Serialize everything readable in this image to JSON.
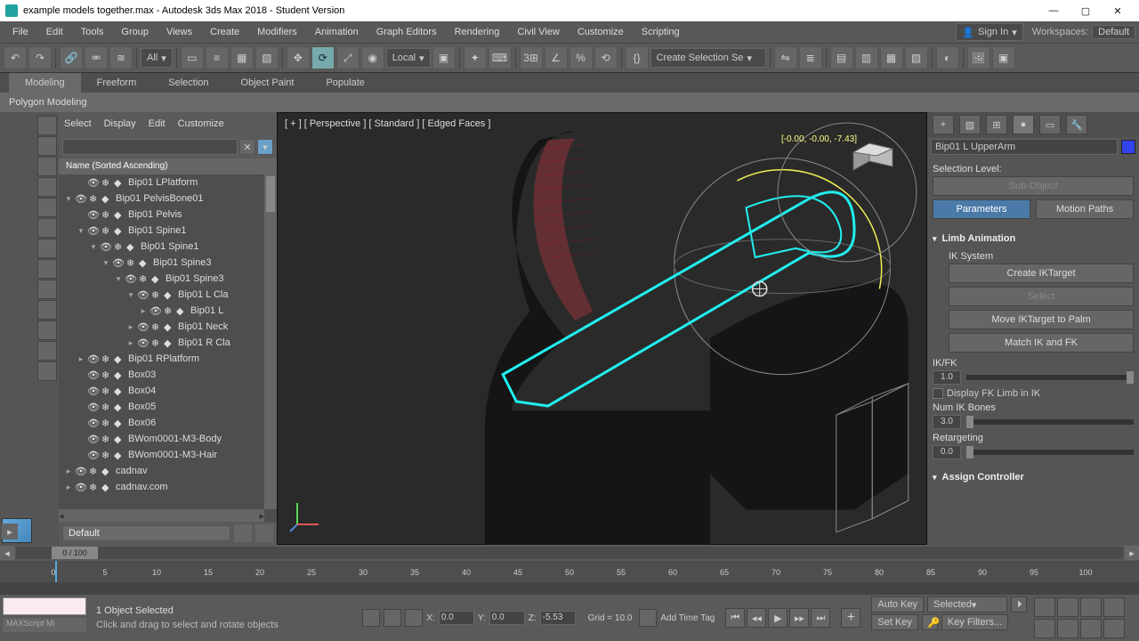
{
  "window": {
    "title": "example models together.max - Autodesk 3ds Max 2018 - Student Version"
  },
  "menu": {
    "items": [
      "File",
      "Edit",
      "Tools",
      "Group",
      "Views",
      "Create",
      "Modifiers",
      "Animation",
      "Graph Editors",
      "Rendering",
      "Civil View",
      "Customize",
      "Scripting"
    ],
    "signin_icon": "person",
    "signin_label": "Sign In",
    "workspaces_label": "Workspaces:",
    "workspaces_value": "Default"
  },
  "toolbar": {
    "coord_select": "All",
    "coord_system": "Local",
    "named_sel": "Create Selection Se"
  },
  "ribbon": {
    "tabs": [
      "Modeling",
      "Freeform",
      "Selection",
      "Object Paint",
      "Populate"
    ],
    "active_index": 0,
    "sub_label": "Polygon Modeling"
  },
  "scene": {
    "menus": [
      "Select",
      "Display",
      "Edit",
      "Customize"
    ],
    "col_header": "Name (Sorted Ascending)",
    "layer_default": "Default",
    "items": [
      {
        "indent": 1,
        "toggle": "",
        "name": "Bip01 LPlatform"
      },
      {
        "indent": 0,
        "toggle": "▾",
        "name": "Bip01 PelvisBone01"
      },
      {
        "indent": 1,
        "toggle": "",
        "name": "Bip01 Pelvis"
      },
      {
        "indent": 1,
        "toggle": "▾",
        "name": "Bip01 Spine1"
      },
      {
        "indent": 2,
        "toggle": "▾",
        "name": "Bip01 Spine1"
      },
      {
        "indent": 3,
        "toggle": "▾",
        "name": "Bip01 Spine3"
      },
      {
        "indent": 4,
        "toggle": "▾",
        "name": "Bip01 Spine3"
      },
      {
        "indent": 5,
        "toggle": "▾",
        "name": "Bip01 L Cla"
      },
      {
        "indent": 6,
        "toggle": "▸",
        "name": "Bip01 L"
      },
      {
        "indent": 5,
        "toggle": "▸",
        "name": "Bip01 Neck"
      },
      {
        "indent": 5,
        "toggle": "▸",
        "name": "Bip01 R Cla"
      },
      {
        "indent": 1,
        "toggle": "▸",
        "name": "Bip01 RPlatform"
      },
      {
        "indent": 1,
        "toggle": "",
        "name": "Box03"
      },
      {
        "indent": 1,
        "toggle": "",
        "name": "Box04"
      },
      {
        "indent": 1,
        "toggle": "",
        "name": "Box05"
      },
      {
        "indent": 1,
        "toggle": "",
        "name": "Box06"
      },
      {
        "indent": 1,
        "toggle": "",
        "name": "BWom0001-M3-Body"
      },
      {
        "indent": 1,
        "toggle": "",
        "name": "BWom0001-M3-Hair"
      },
      {
        "indent": 0,
        "toggle": "▸",
        "name": "cadnav"
      },
      {
        "indent": 0,
        "toggle": "▸",
        "name": "cadnav.com"
      }
    ]
  },
  "viewport": {
    "label": "[ + ] [ Perspective ] [ Standard ] [ Edged Faces ]",
    "coords": "[-0.00, -0.00, -7.43]"
  },
  "command": {
    "object_name": "Bip01 L UpperArm",
    "selection_label": "Selection Level:",
    "subobject_btn": "Sub-Object",
    "parameters_btn": "Parameters",
    "motionpaths_btn": "Motion Paths",
    "rollout1": {
      "title": "Limb Animation",
      "ik_system_label": "IK System",
      "create_ik": "Create IKTarget",
      "select_btn": "Select",
      "move_btn": "Move IKTarget to Palm",
      "match_btn": "Match IK and FK",
      "ikfk_label": "IK/FK",
      "ikfk_val": "1.0",
      "display_fk": "Display FK Limb in IK",
      "numik_label": "Num IK Bones",
      "numik_val": "3.0",
      "retarget_label": "Retargeting",
      "retarget_val": "0.0"
    },
    "rollout2": {
      "title": "Assign Controller"
    }
  },
  "timeline": {
    "handle": "0 / 100",
    "ticks": [
      "0",
      "5",
      "10",
      "15",
      "20",
      "25",
      "30",
      "35",
      "40",
      "45",
      "50",
      "55",
      "60",
      "65",
      "70",
      "75",
      "80",
      "85",
      "90",
      "95",
      "100"
    ]
  },
  "status": {
    "maxscript_hint": "MAXScript Mi",
    "selected": "1 Object Selected",
    "prompt": "Click and drag to select and rotate objects",
    "x_label": "X:",
    "x_val": "0.0",
    "y_label": "Y:",
    "y_val": "0.0",
    "z_label": "Z:",
    "z_val": "-5.53",
    "grid_label": "Grid = 10.0",
    "addtime": "Add Time Tag",
    "autokey": "Auto Key",
    "setkey": "Set Key",
    "keymode": "Selected",
    "keyfilters": "Key Filters..."
  }
}
